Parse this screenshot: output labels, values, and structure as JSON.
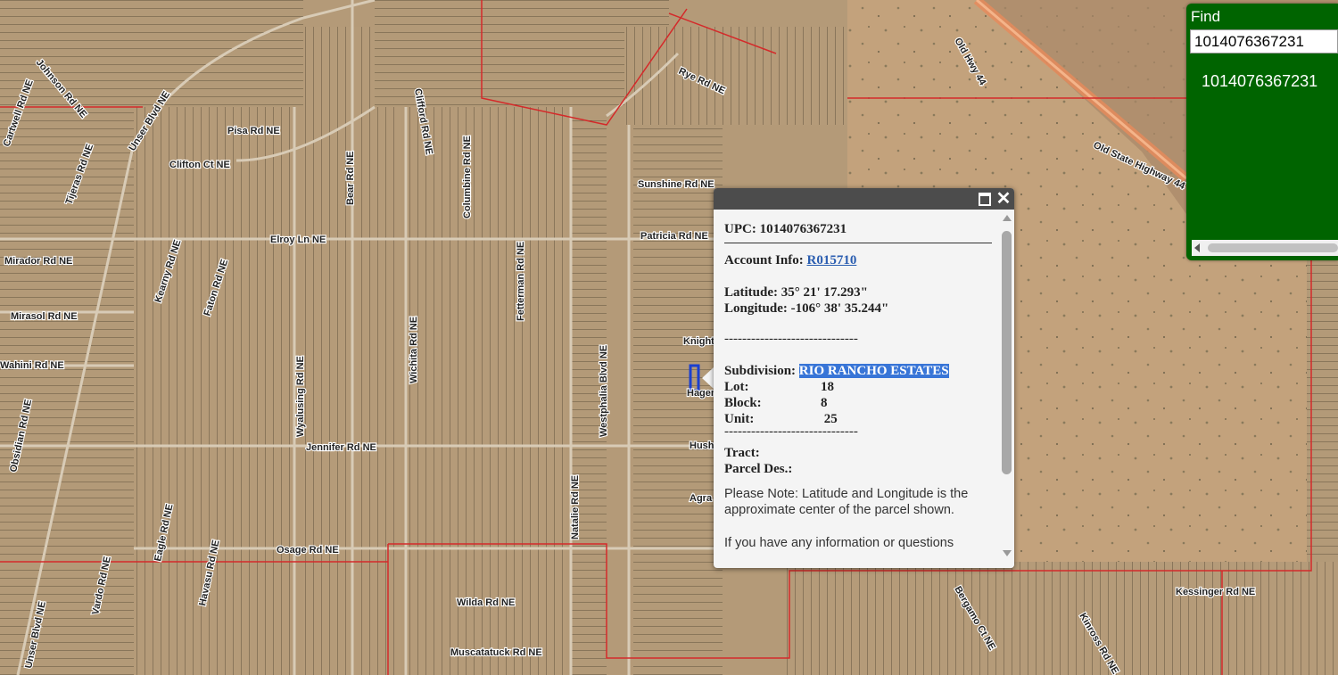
{
  "find": {
    "title": "Find",
    "input_value": "1014076367231",
    "result": "1014076367231"
  },
  "popup": {
    "upc_label": "UPC:",
    "upc_value": "1014076367231",
    "account_label": "Account Info:",
    "account_value": "R015710",
    "latitude_label": "Latitude:",
    "latitude_value": "35° 21' 17.293\"",
    "longitude_label": "Longitude:",
    "longitude_value": "-106° 38' 35.244\"",
    "separator": "------------------------------",
    "subdivision_label": "Subdivision:",
    "subdivision_value": "RIO RANCHO ESTATES",
    "lot_label": "Lot:",
    "lot_value": "18",
    "block_label": "Block:",
    "block_value": "8",
    "unit_label": "Unit:",
    "unit_value": " 25",
    "separator2": "------------------------------",
    "tract_label": "Tract:",
    "parcel_des_label": "Parcel Des.:",
    "note": "Please Note: Latitude and Longitude is the approximate center of the parcel shown.",
    "cut_text": "If you have any information or questions"
  },
  "map": {
    "colors": {
      "imagery": "#b49a78",
      "grid": "#4a3e2e",
      "boundary": "#d42a2a",
      "highway": "#e8895a",
      "selection": "#1a3fd0"
    },
    "road_labels": [
      "Johnson Rd NE",
      "Cartwell Rd NE",
      "Unser Blvd NE",
      "Tijeras Rd NE",
      "Clifton Ct NE",
      "Kearny Rd NE",
      "Faton Rd NE",
      "Pisa Rd NE",
      "Mirador Rd NE",
      "Mirasol Rd NE",
      "Wahini Rd NE",
      "Obsidian Rd NE",
      "Clifford Rd NE",
      "Bear Rd NE",
      "Columbine Rd NE",
      "Elroy Ln NE",
      "Patricia Rd NE",
      "Sunshine Rd NE",
      "Westphalia Blvd NE",
      "Jennifer Rd NE",
      "Fetterman Rd NE",
      "Wyalusing Rd NE",
      "Wichita Rd NE",
      "Natalie Rd NE",
      "Osage Rd NE",
      "Wilda Rd NE",
      "Muscatatuck Rd NE",
      "Unser Blvd NE",
      "Vardo Rd NE",
      "Eagle Rd NE",
      "Havasu Rd NE",
      "Rye Rd NE",
      "Old Hwy 44",
      "Old State Highway 44",
      "Kessinger Rd NE",
      "Kinross Rd NE",
      "Bergamo Ct NE",
      "Knight",
      "Hagen",
      "Hush",
      "Agra"
    ]
  }
}
